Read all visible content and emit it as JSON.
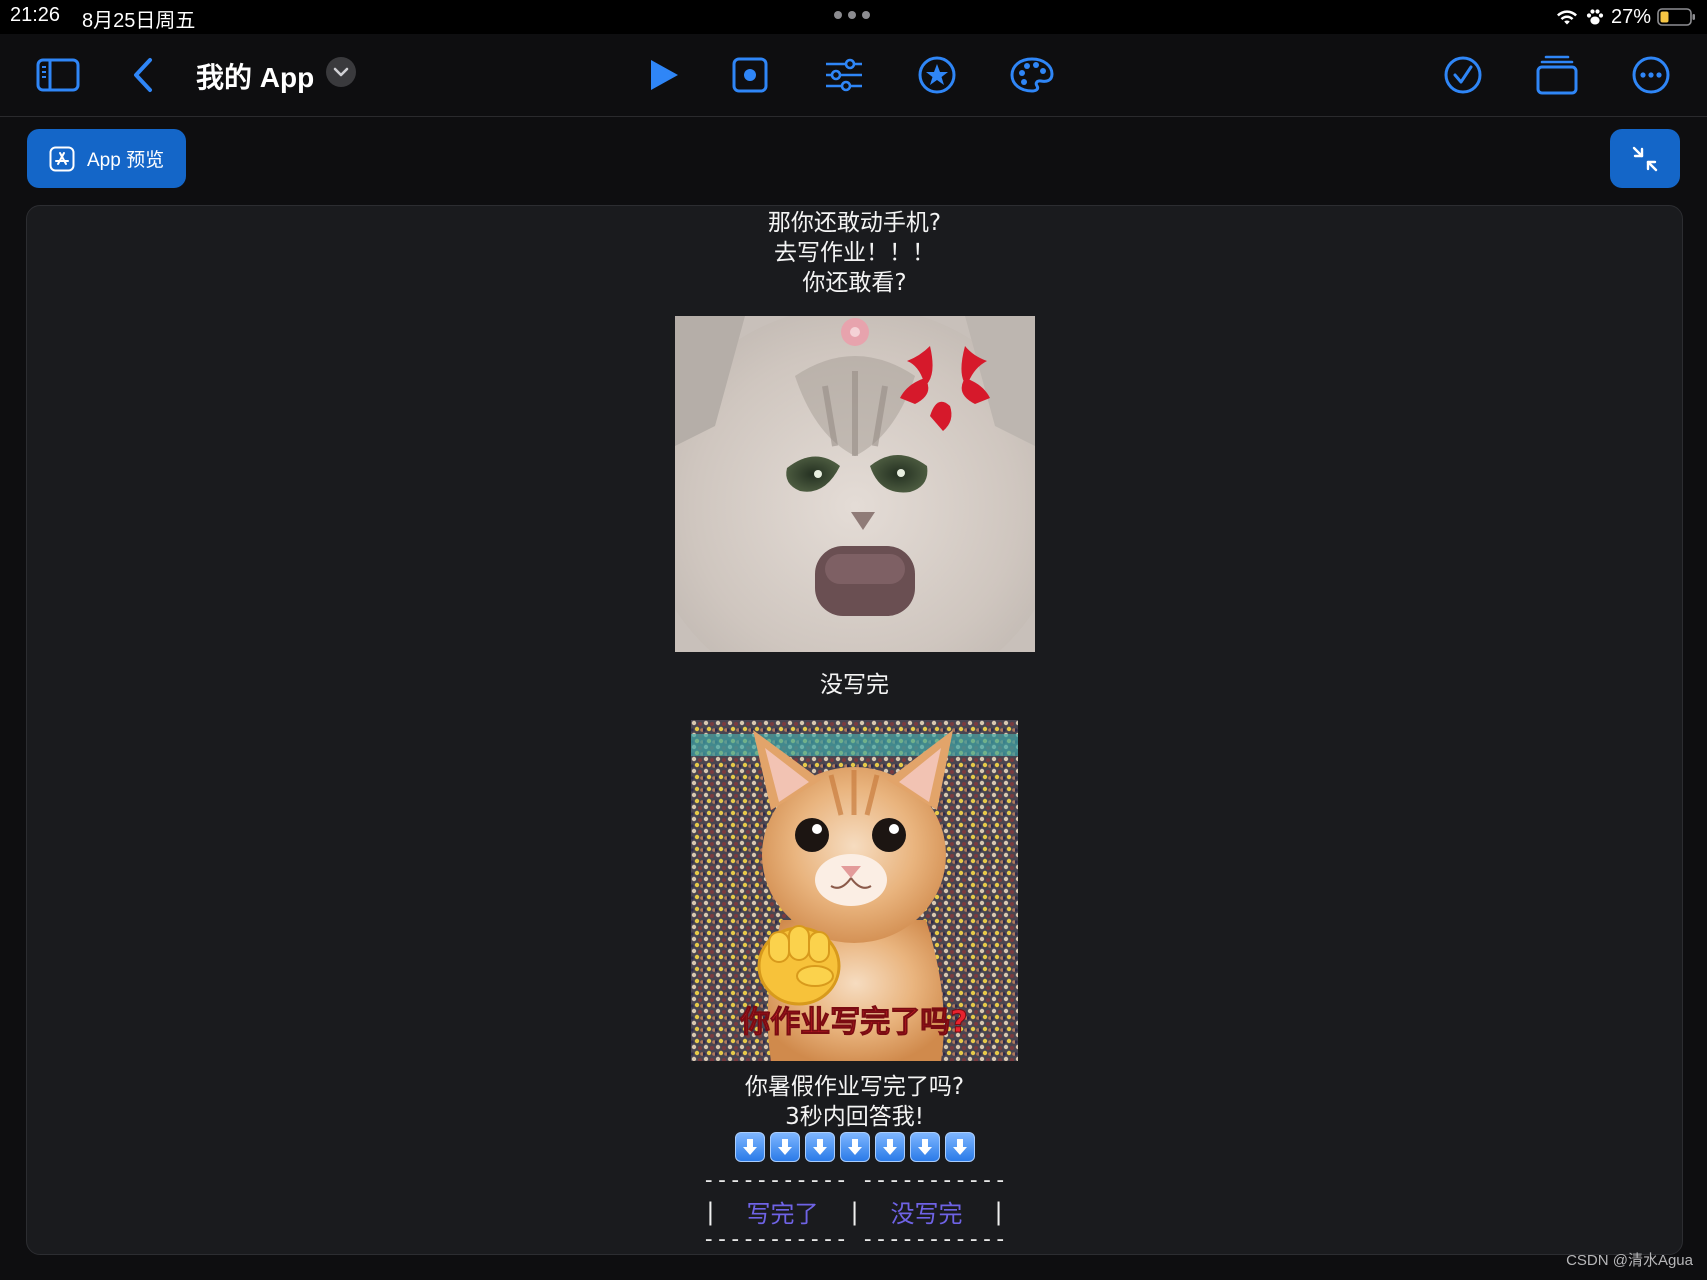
{
  "status_bar": {
    "time": "21:26",
    "date": "8月25日周五",
    "battery_text": "27%"
  },
  "toolbar": {
    "app_title": "我的 App",
    "icons": [
      "sidebar-icon",
      "back-chevron-icon",
      "play-icon",
      "record-icon",
      "sliders-icon",
      "star-icon",
      "palette-icon",
      "checkmark-icon",
      "stack-icon",
      "more-icon"
    ]
  },
  "preview": {
    "button_label": "App 预览"
  },
  "content": {
    "intro_lines": [
      "那你还敢动手机?",
      "去写作业！！！",
      "你还敢看?"
    ],
    "caption_1": "没写完",
    "image_2_overlay_text": "你作业写完了吗?",
    "question_lines": [
      "你暑假作业写完了吗?",
      "3秒内回答我!"
    ],
    "arrow_count": 7,
    "dashes_line": "----------- -----------",
    "pipe": "|",
    "choice_done": "写完了",
    "choice_not_done": "没写完"
  },
  "watermark": "CSDN @清水Agua",
  "colors": {
    "accent": "#1466c8",
    "link": "#6f63e6",
    "preview_bg": "#1a1b1e",
    "toolbar_icon": "#2f86f7"
  }
}
